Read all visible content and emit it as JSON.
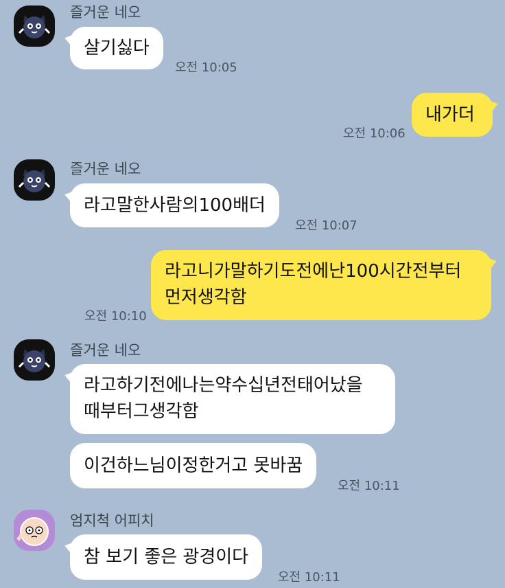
{
  "messages": [
    {
      "sender": "즐거운 네오",
      "text": "살기싫다",
      "time": "오전 10:05"
    },
    {
      "text": "내가더",
      "time": "오전 10:06"
    },
    {
      "sender": "즐거운 네오",
      "text": "라고말한사람의100배더",
      "time": "오전 10:07"
    },
    {
      "lines": [
        "라고니가말하기도전에난100시간전부터",
        "먼저생각함"
      ],
      "time": "오전 10:10"
    },
    {
      "sender": "즐거운 네오",
      "lines": [
        "라고하기전에나는약수십년전태어났을",
        "때부터그생각함"
      ]
    },
    {
      "text": "이건하느님이정한거고 못바꿈",
      "time": "오전 10:11"
    },
    {
      "sender": "엄지척 어피치",
      "text": "참 보기 좋은 광경이다",
      "time": "오전 10:11"
    }
  ],
  "colors": {
    "background": "#a9bcd1",
    "incoming": "#ffffff",
    "outgoing": "#fde74c"
  }
}
